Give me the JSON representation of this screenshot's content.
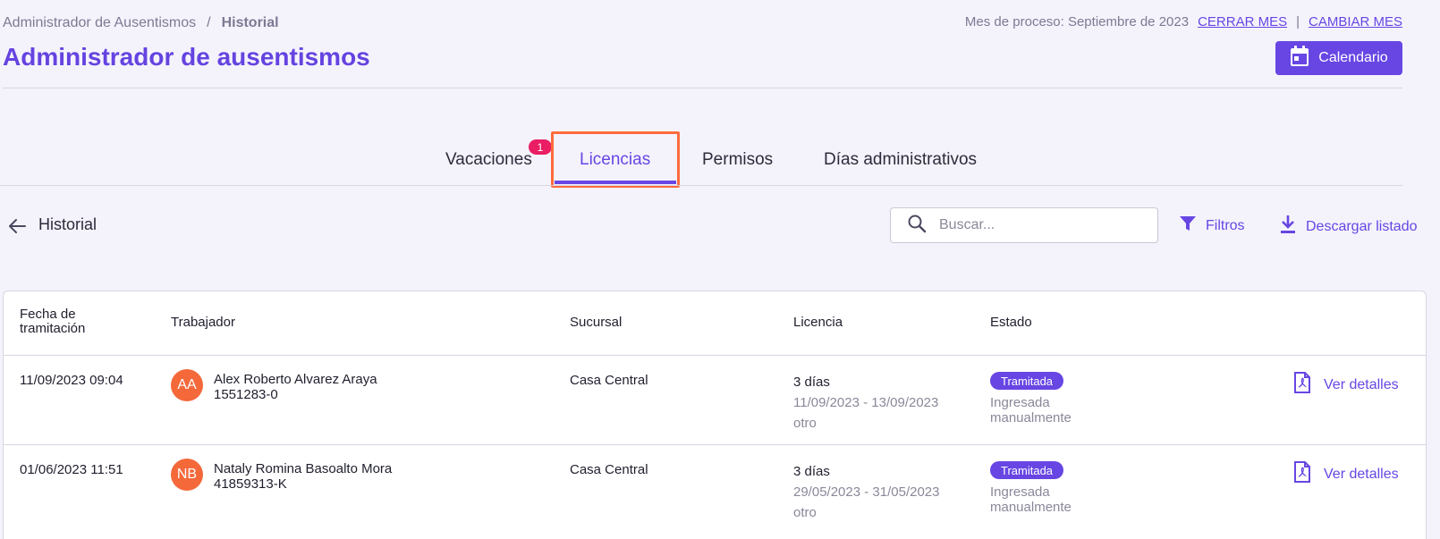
{
  "breadcrumb": {
    "parent": "Administrador de Ausentismos",
    "separator": "/",
    "current": "Historial"
  },
  "process": {
    "label": "Mes de proceso: Septiembre de 2023",
    "close_month": "CERRAR MES",
    "divider": "|",
    "change_month": "CAMBIAR MES"
  },
  "page_title": "Administrador de ausentismos",
  "calendar_button": {
    "label": "Calendario",
    "icon": "calendar-icon"
  },
  "tabs": [
    {
      "label": "Vacaciones",
      "badge": "1"
    },
    {
      "label": "Licencias",
      "active": true
    },
    {
      "label": "Permisos"
    },
    {
      "label": "Días administrativos"
    }
  ],
  "toolbar": {
    "title": "Historial",
    "search_placeholder": "Buscar...",
    "filters_label": "Filtros",
    "download_label": "Descargar listado"
  },
  "table": {
    "headers": {
      "date_l1": "Fecha de",
      "date_l2": "tramitación",
      "worker": "Trabajador",
      "branch": "Sucursal",
      "license": "Licencia",
      "status": "Estado"
    },
    "rows": [
      {
        "date": "11/09/2023 09:04",
        "initials": "AA",
        "name": "Alex Roberto Alvarez Araya",
        "rut": "1551283-0",
        "branch": "Casa Central",
        "days": "3 días",
        "range": "11/09/2023 - 13/09/2023",
        "type": "otro",
        "status": "Tramitada",
        "origin_l1": "Ingresada",
        "origin_l2": "manualmente",
        "action": "Ver detalles"
      },
      {
        "date": "01/06/2023 11:51",
        "initials": "NB",
        "name": "Nataly Romina Basoalto Mora",
        "rut": "41859313-K",
        "branch": "Casa Central",
        "days": "3 días",
        "range": "29/05/2023 - 31/05/2023",
        "type": "otro",
        "status": "Tramitada",
        "origin_l1": "Ingresada",
        "origin_l2": "manualmente",
        "action": "Ver detalles"
      }
    ]
  },
  "colors": {
    "accent": "#6746e3",
    "badge": "#e91e63",
    "avatar": "#f4683a",
    "highlight": "#ff6b3d",
    "background": "#f4f3fc"
  }
}
